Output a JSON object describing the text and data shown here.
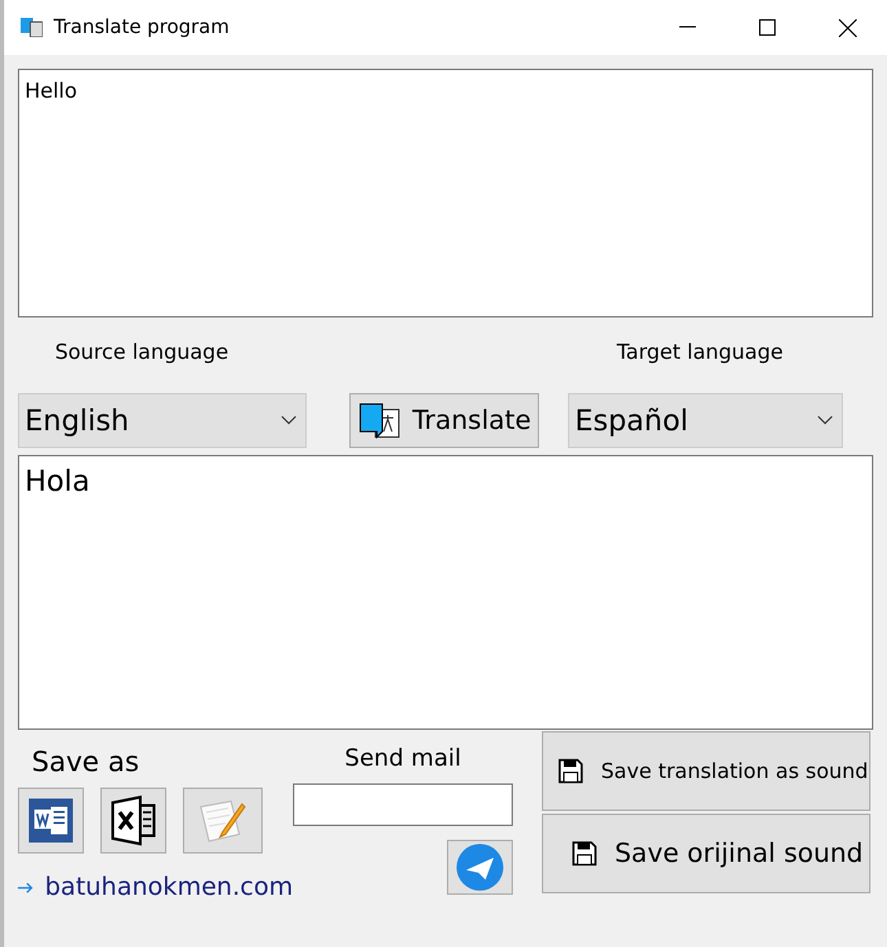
{
  "window": {
    "title": "Translate program"
  },
  "source_text": "Hello",
  "source_language": {
    "label": "Source language",
    "value": "English"
  },
  "translate_button": "Translate",
  "target_language": {
    "label": "Target language",
    "value": "Español"
  },
  "result_text": "Hola",
  "save_as": {
    "label": "Save as",
    "buttons": [
      {
        "kind": "word"
      },
      {
        "kind": "excel"
      },
      {
        "kind": "notepad"
      }
    ]
  },
  "send_mail": {
    "label": "Send mail"
  },
  "link": "batuhanokmen.com",
  "sound_buttons": [
    {
      "label": "Save translation as sound"
    },
    {
      "label": "Save orijinal sound"
    }
  ]
}
